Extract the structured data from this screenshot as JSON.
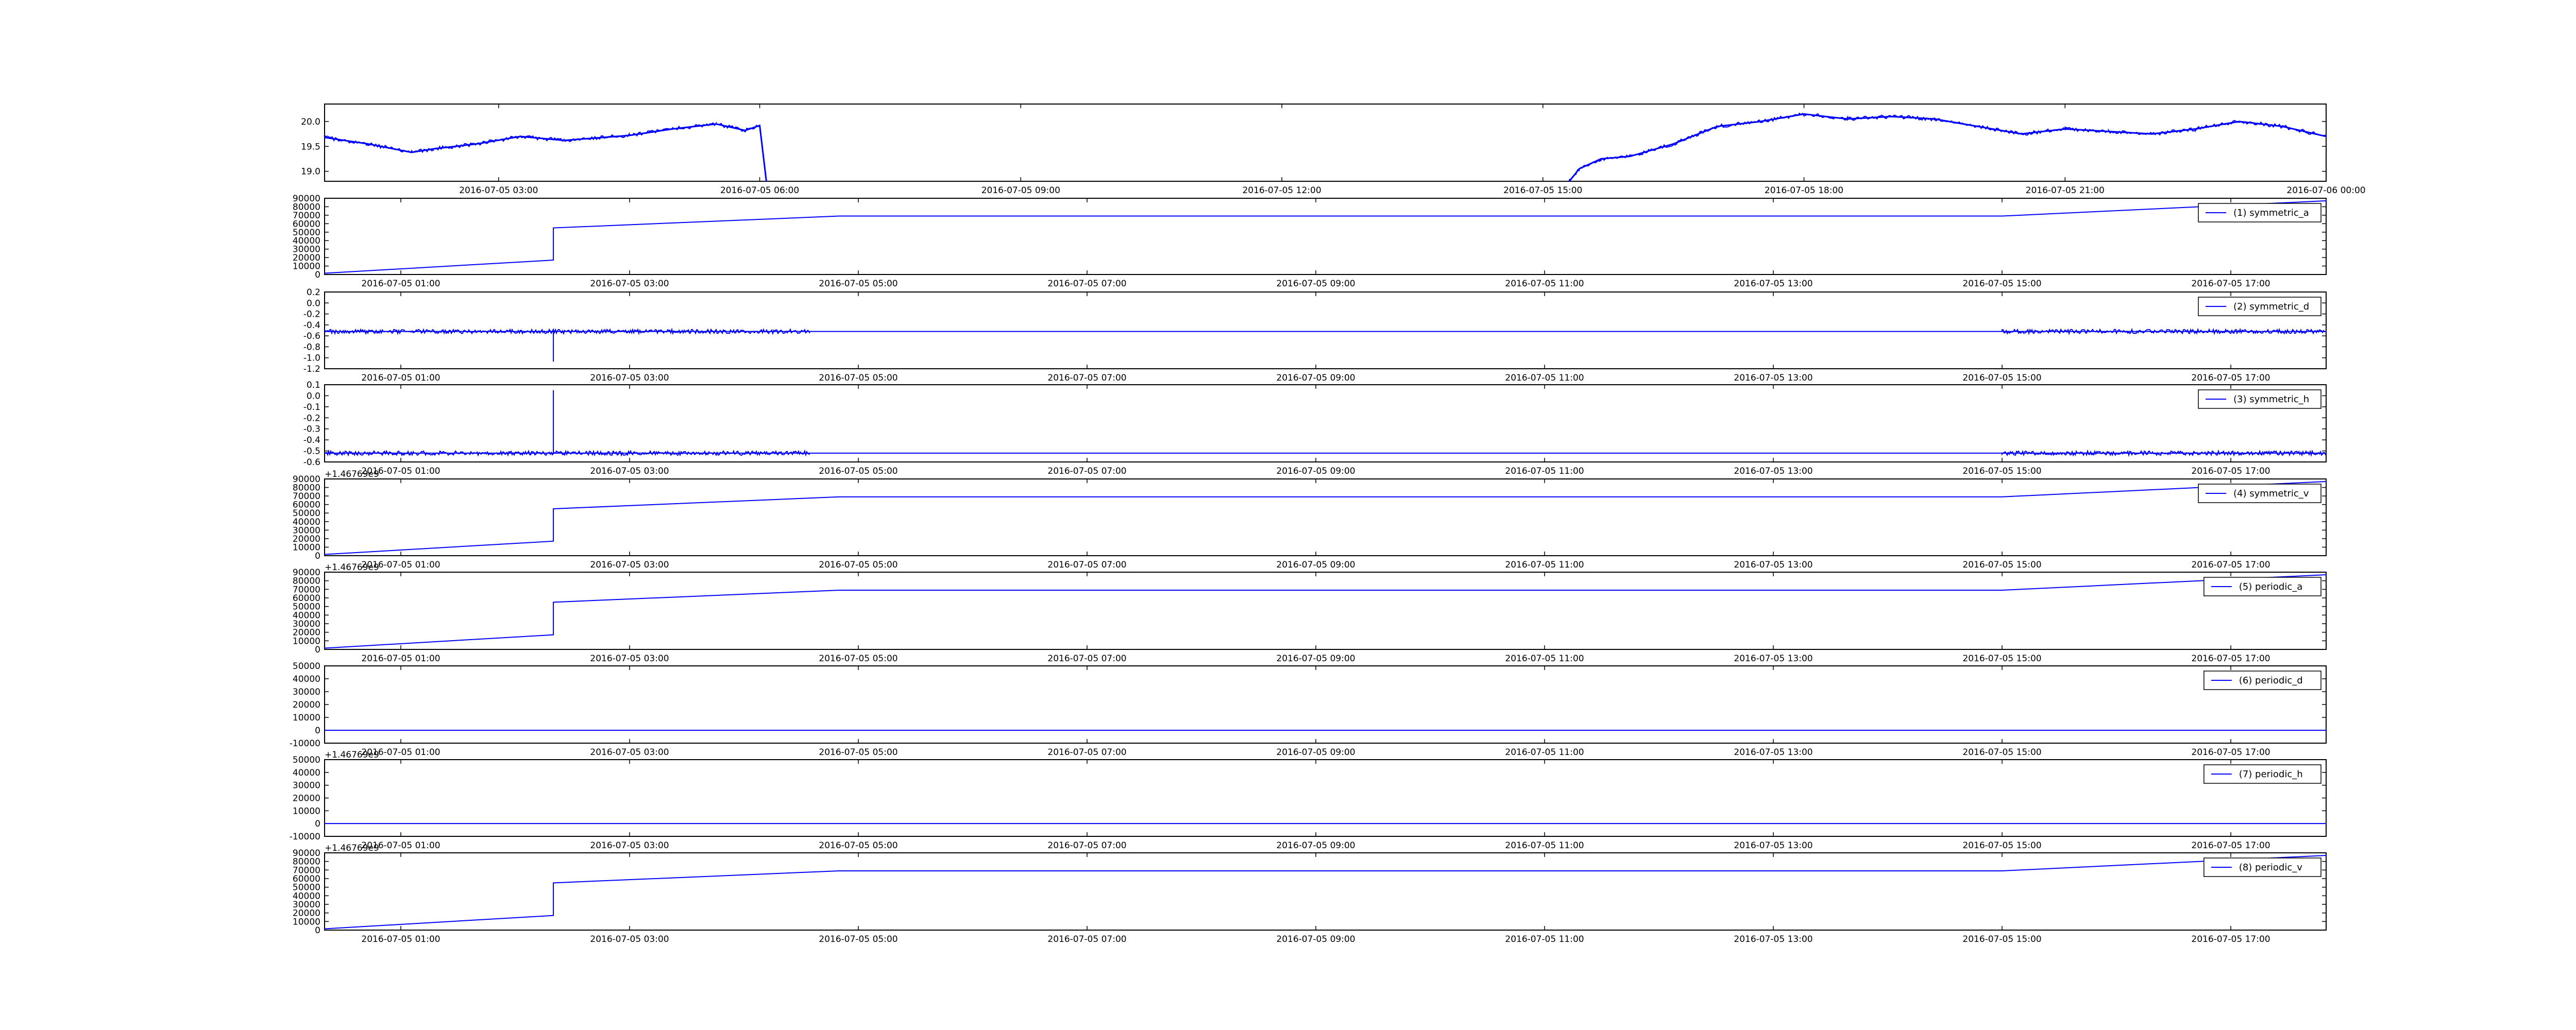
{
  "figure": {
    "colors": {
      "series": "#0000ff",
      "axes": "#000000",
      "background": "#ffffff"
    }
  },
  "chart_data": [
    {
      "type": "line",
      "title": "",
      "xlabel": "",
      "ylabel": "",
      "x_ticks": [
        "2016-07-05 03:00",
        "2016-07-05 06:00",
        "2016-07-05 09:00",
        "2016-07-05 12:00",
        "2016-07-05 15:00",
        "2016-07-05 18:00",
        "2016-07-05 21:00",
        "2016-07-06 00:00"
      ],
      "xlim": [
        "2016-07-05 01:00",
        "2016-07-06 00:00"
      ],
      "y_ticks": [
        "19.0",
        "19.5",
        "20.0"
      ],
      "ylim": [
        18.8,
        20.35
      ],
      "offset_label": "",
      "legend": null,
      "series": [
        {
          "x": [
            "2016-07-05 01:00",
            "2016-07-05 01:30",
            "2016-07-05 02:00",
            "2016-07-05 02:15",
            "2016-07-05 02:45",
            "2016-07-05 03:15",
            "2016-07-05 03:45",
            "2016-07-05 04:30",
            "2016-07-05 05:00",
            "2016-07-05 05:30",
            "2016-07-05 05:50",
            "2016-07-05 06:00",
            "2016-07-05 06:05",
            "2016-07-05 15:00",
            "2016-07-05 15:15",
            "2016-07-05 15:25",
            "2016-07-05 15:40",
            "2016-07-05 16:00",
            "2016-07-05 16:30",
            "2016-07-05 17:00",
            "2016-07-05 17:30",
            "2016-07-05 18:00",
            "2016-07-05 18:30",
            "2016-07-05 19:00",
            "2016-07-05 19:30",
            "2016-07-05 20:00",
            "2016-07-05 20:30",
            "2016-07-05 21:00",
            "2016-07-05 21:30",
            "2016-07-05 22:00",
            "2016-07-05 22:30",
            "2016-07-05 23:00",
            "2016-07-05 23:30",
            "2016-07-06 00:00"
          ],
          "y": [
            19.68,
            19.55,
            19.38,
            19.45,
            19.55,
            19.7,
            19.62,
            19.72,
            19.85,
            19.95,
            19.82,
            19.92,
            18.7,
            18.7,
            18.68,
            19.05,
            19.25,
            19.3,
            19.55,
            19.9,
            20.0,
            20.15,
            20.05,
            20.1,
            20.05,
            19.9,
            19.75,
            19.85,
            19.8,
            19.75,
            19.85,
            20.0,
            19.9,
            19.7
          ]
        }
      ]
    },
    {
      "type": "line",
      "x_ticks": [
        "2016-07-05 01:00",
        "2016-07-05 03:00",
        "2016-07-05 05:00",
        "2016-07-05 07:00",
        "2016-07-05 09:00",
        "2016-07-05 11:00",
        "2016-07-05 13:00",
        "2016-07-05 15:00",
        "2016-07-05 17:00"
      ],
      "xlim": [
        "2016-07-05 00:20",
        "2016-07-05 17:50"
      ],
      "y_ticks": [
        "0",
        "10000",
        "20000",
        "30000",
        "40000",
        "50000",
        "60000",
        "70000",
        "80000",
        "90000"
      ],
      "ylim": [
        0,
        90000
      ],
      "offset_label": "",
      "legend": "(1) symmetric_a",
      "series": [
        {
          "name": "(1) symmetric_a",
          "x": [
            "2016-07-05 00:20",
            "2016-07-05 02:20",
            "2016-07-05 02:20",
            "2016-07-05 04:50",
            "2016-07-05 15:00",
            "2016-07-05 17:50"
          ],
          "y": [
            1500,
            17000,
            55000,
            69000,
            69000,
            87000
          ]
        }
      ]
    },
    {
      "type": "line",
      "x_ticks": [
        "2016-07-05 01:00",
        "2016-07-05 03:00",
        "2016-07-05 05:00",
        "2016-07-05 07:00",
        "2016-07-05 09:00",
        "2016-07-05 11:00",
        "2016-07-05 13:00",
        "2016-07-05 15:00",
        "2016-07-05 17:00"
      ],
      "xlim": [
        "2016-07-05 00:20",
        "2016-07-05 17:50"
      ],
      "y_ticks": [
        "-1.2",
        "-1.0",
        "-0.8",
        "-0.6",
        "-0.4",
        "-0.2",
        "0.0",
        "0.2"
      ],
      "ylim": [
        -1.2,
        0.2
      ],
      "offset_label": "",
      "legend": "(2) symmetric_d",
      "series": [
        {
          "name": "(2) symmetric_d",
          "x": [
            "2016-07-05 00:20",
            "2016-07-05 02:20",
            "2016-07-05 02:20",
            "2016-07-05 02:20",
            "2016-07-05 04:35",
            "2016-07-05 15:00",
            "2016-07-05 17:50"
          ],
          "y": [
            -0.52,
            -0.52,
            -1.07,
            -0.52,
            -0.52,
            -0.52,
            -0.52
          ]
        }
      ]
    },
    {
      "type": "line",
      "x_ticks": [
        "2016-07-05 01:00",
        "2016-07-05 03:00",
        "2016-07-05 05:00",
        "2016-07-05 07:00",
        "2016-07-05 09:00",
        "2016-07-05 11:00",
        "2016-07-05 13:00",
        "2016-07-05 15:00",
        "2016-07-05 17:00"
      ],
      "xlim": [
        "2016-07-05 00:20",
        "2016-07-05 17:50"
      ],
      "y_ticks": [
        "-0.6",
        "-0.5",
        "-0.4",
        "-0.3",
        "-0.2",
        "-0.1",
        "0.0",
        "0.1"
      ],
      "ylim": [
        -0.6,
        0.1
      ],
      "offset_label": "",
      "legend": "(3) symmetric_h",
      "series": [
        {
          "name": "(3) symmetric_h",
          "x": [
            "2016-07-05 00:20",
            "2016-07-05 02:20",
            "2016-07-05 02:20",
            "2016-07-05 02:20",
            "2016-07-05 04:35",
            "2016-07-05 15:00",
            "2016-07-05 17:50"
          ],
          "y": [
            -0.52,
            -0.52,
            0.05,
            -0.52,
            -0.52,
            -0.52,
            -0.52
          ]
        }
      ]
    },
    {
      "type": "line",
      "x_ticks": [
        "2016-07-05 01:00",
        "2016-07-05 03:00",
        "2016-07-05 05:00",
        "2016-07-05 07:00",
        "2016-07-05 09:00",
        "2016-07-05 11:00",
        "2016-07-05 13:00",
        "2016-07-05 15:00",
        "2016-07-05 17:00"
      ],
      "xlim": [
        "2016-07-05 00:20",
        "2016-07-05 17:50"
      ],
      "y_ticks": [
        "0",
        "10000",
        "20000",
        "30000",
        "40000",
        "50000",
        "60000",
        "70000",
        "80000",
        "90000"
      ],
      "ylim": [
        0,
        90000
      ],
      "offset_label": "+1.46769e9",
      "legend": "(4) symmetric_v",
      "series": [
        {
          "name": "(4) symmetric_v",
          "x": [
            "2016-07-05 00:20",
            "2016-07-05 02:20",
            "2016-07-05 02:20",
            "2016-07-05 04:50",
            "2016-07-05 15:00",
            "2016-07-05 17:50"
          ],
          "y": [
            1500,
            17000,
            55000,
            69000,
            69000,
            87000
          ]
        }
      ]
    },
    {
      "type": "line",
      "x_ticks": [
        "2016-07-05 01:00",
        "2016-07-05 03:00",
        "2016-07-05 05:00",
        "2016-07-05 07:00",
        "2016-07-05 09:00",
        "2016-07-05 11:00",
        "2016-07-05 13:00",
        "2016-07-05 15:00",
        "2016-07-05 17:00"
      ],
      "xlim": [
        "2016-07-05 00:20",
        "2016-07-05 17:50"
      ],
      "y_ticks": [
        "0",
        "10000",
        "20000",
        "30000",
        "40000",
        "50000",
        "60000",
        "70000",
        "80000",
        "90000"
      ],
      "ylim": [
        0,
        90000
      ],
      "offset_label": "+1.46769e9",
      "legend": "(5) periodic_a",
      "series": [
        {
          "name": "(5) periodic_a",
          "x": [
            "2016-07-05 00:20",
            "2016-07-05 02:20",
            "2016-07-05 02:20",
            "2016-07-05 04:50",
            "2016-07-05 15:00",
            "2016-07-05 17:50"
          ],
          "y": [
            1500,
            17000,
            55000,
            69000,
            69000,
            87000
          ]
        }
      ]
    },
    {
      "type": "line",
      "x_ticks": [
        "2016-07-05 01:00",
        "2016-07-05 03:00",
        "2016-07-05 05:00",
        "2016-07-05 07:00",
        "2016-07-05 09:00",
        "2016-07-05 11:00",
        "2016-07-05 13:00",
        "2016-07-05 15:00",
        "2016-07-05 17:00"
      ],
      "xlim": [
        "2016-07-05 00:20",
        "2016-07-05 17:50"
      ],
      "y_ticks": [
        "-10000",
        "0",
        "10000",
        "20000",
        "30000",
        "40000",
        "50000"
      ],
      "ylim": [
        -10000,
        50000
      ],
      "offset_label": "",
      "legend": "(6) periodic_d",
      "series": [
        {
          "name": "(6) periodic_d",
          "x": [
            "2016-07-05 00:20",
            "2016-07-05 17:50"
          ],
          "y": [
            0,
            0
          ]
        }
      ]
    },
    {
      "type": "line",
      "x_ticks": [
        "2016-07-05 01:00",
        "2016-07-05 03:00",
        "2016-07-05 05:00",
        "2016-07-05 07:00",
        "2016-07-05 09:00",
        "2016-07-05 11:00",
        "2016-07-05 13:00",
        "2016-07-05 15:00",
        "2016-07-05 17:00"
      ],
      "xlim": [
        "2016-07-05 00:20",
        "2016-07-05 17:50"
      ],
      "y_ticks": [
        "-10000",
        "0",
        "10000",
        "20000",
        "30000",
        "40000",
        "50000"
      ],
      "ylim": [
        -10000,
        50000
      ],
      "offset_label": "+1.46769e9",
      "legend": "(7) periodic_h",
      "series": [
        {
          "name": "(7) periodic_h",
          "x": [
            "2016-07-05 00:20",
            "2016-07-05 17:50"
          ],
          "y": [
            0,
            0
          ]
        }
      ]
    },
    {
      "type": "line",
      "x_ticks": [
        "2016-07-05 01:00",
        "2016-07-05 03:00",
        "2016-07-05 05:00",
        "2016-07-05 07:00",
        "2016-07-05 09:00",
        "2016-07-05 11:00",
        "2016-07-05 13:00",
        "2016-07-05 15:00",
        "2016-07-05 17:00"
      ],
      "xlim": [
        "2016-07-05 00:20",
        "2016-07-05 17:50"
      ],
      "y_ticks": [
        "0",
        "10000",
        "20000",
        "30000",
        "40000",
        "50000",
        "60000",
        "70000",
        "80000",
        "90000"
      ],
      "ylim": [
        0,
        90000
      ],
      "offset_label": "+1.46769e9",
      "legend": "(8) periodic_v",
      "series": [
        {
          "name": "(8) periodic_v",
          "x": [
            "2016-07-05 00:20",
            "2016-07-05 02:20",
            "2016-07-05 02:20",
            "2016-07-05 04:50",
            "2016-07-05 15:00",
            "2016-07-05 17:50"
          ],
          "y": [
            1500,
            17000,
            55000,
            69000,
            69000,
            87000
          ]
        }
      ]
    }
  ]
}
